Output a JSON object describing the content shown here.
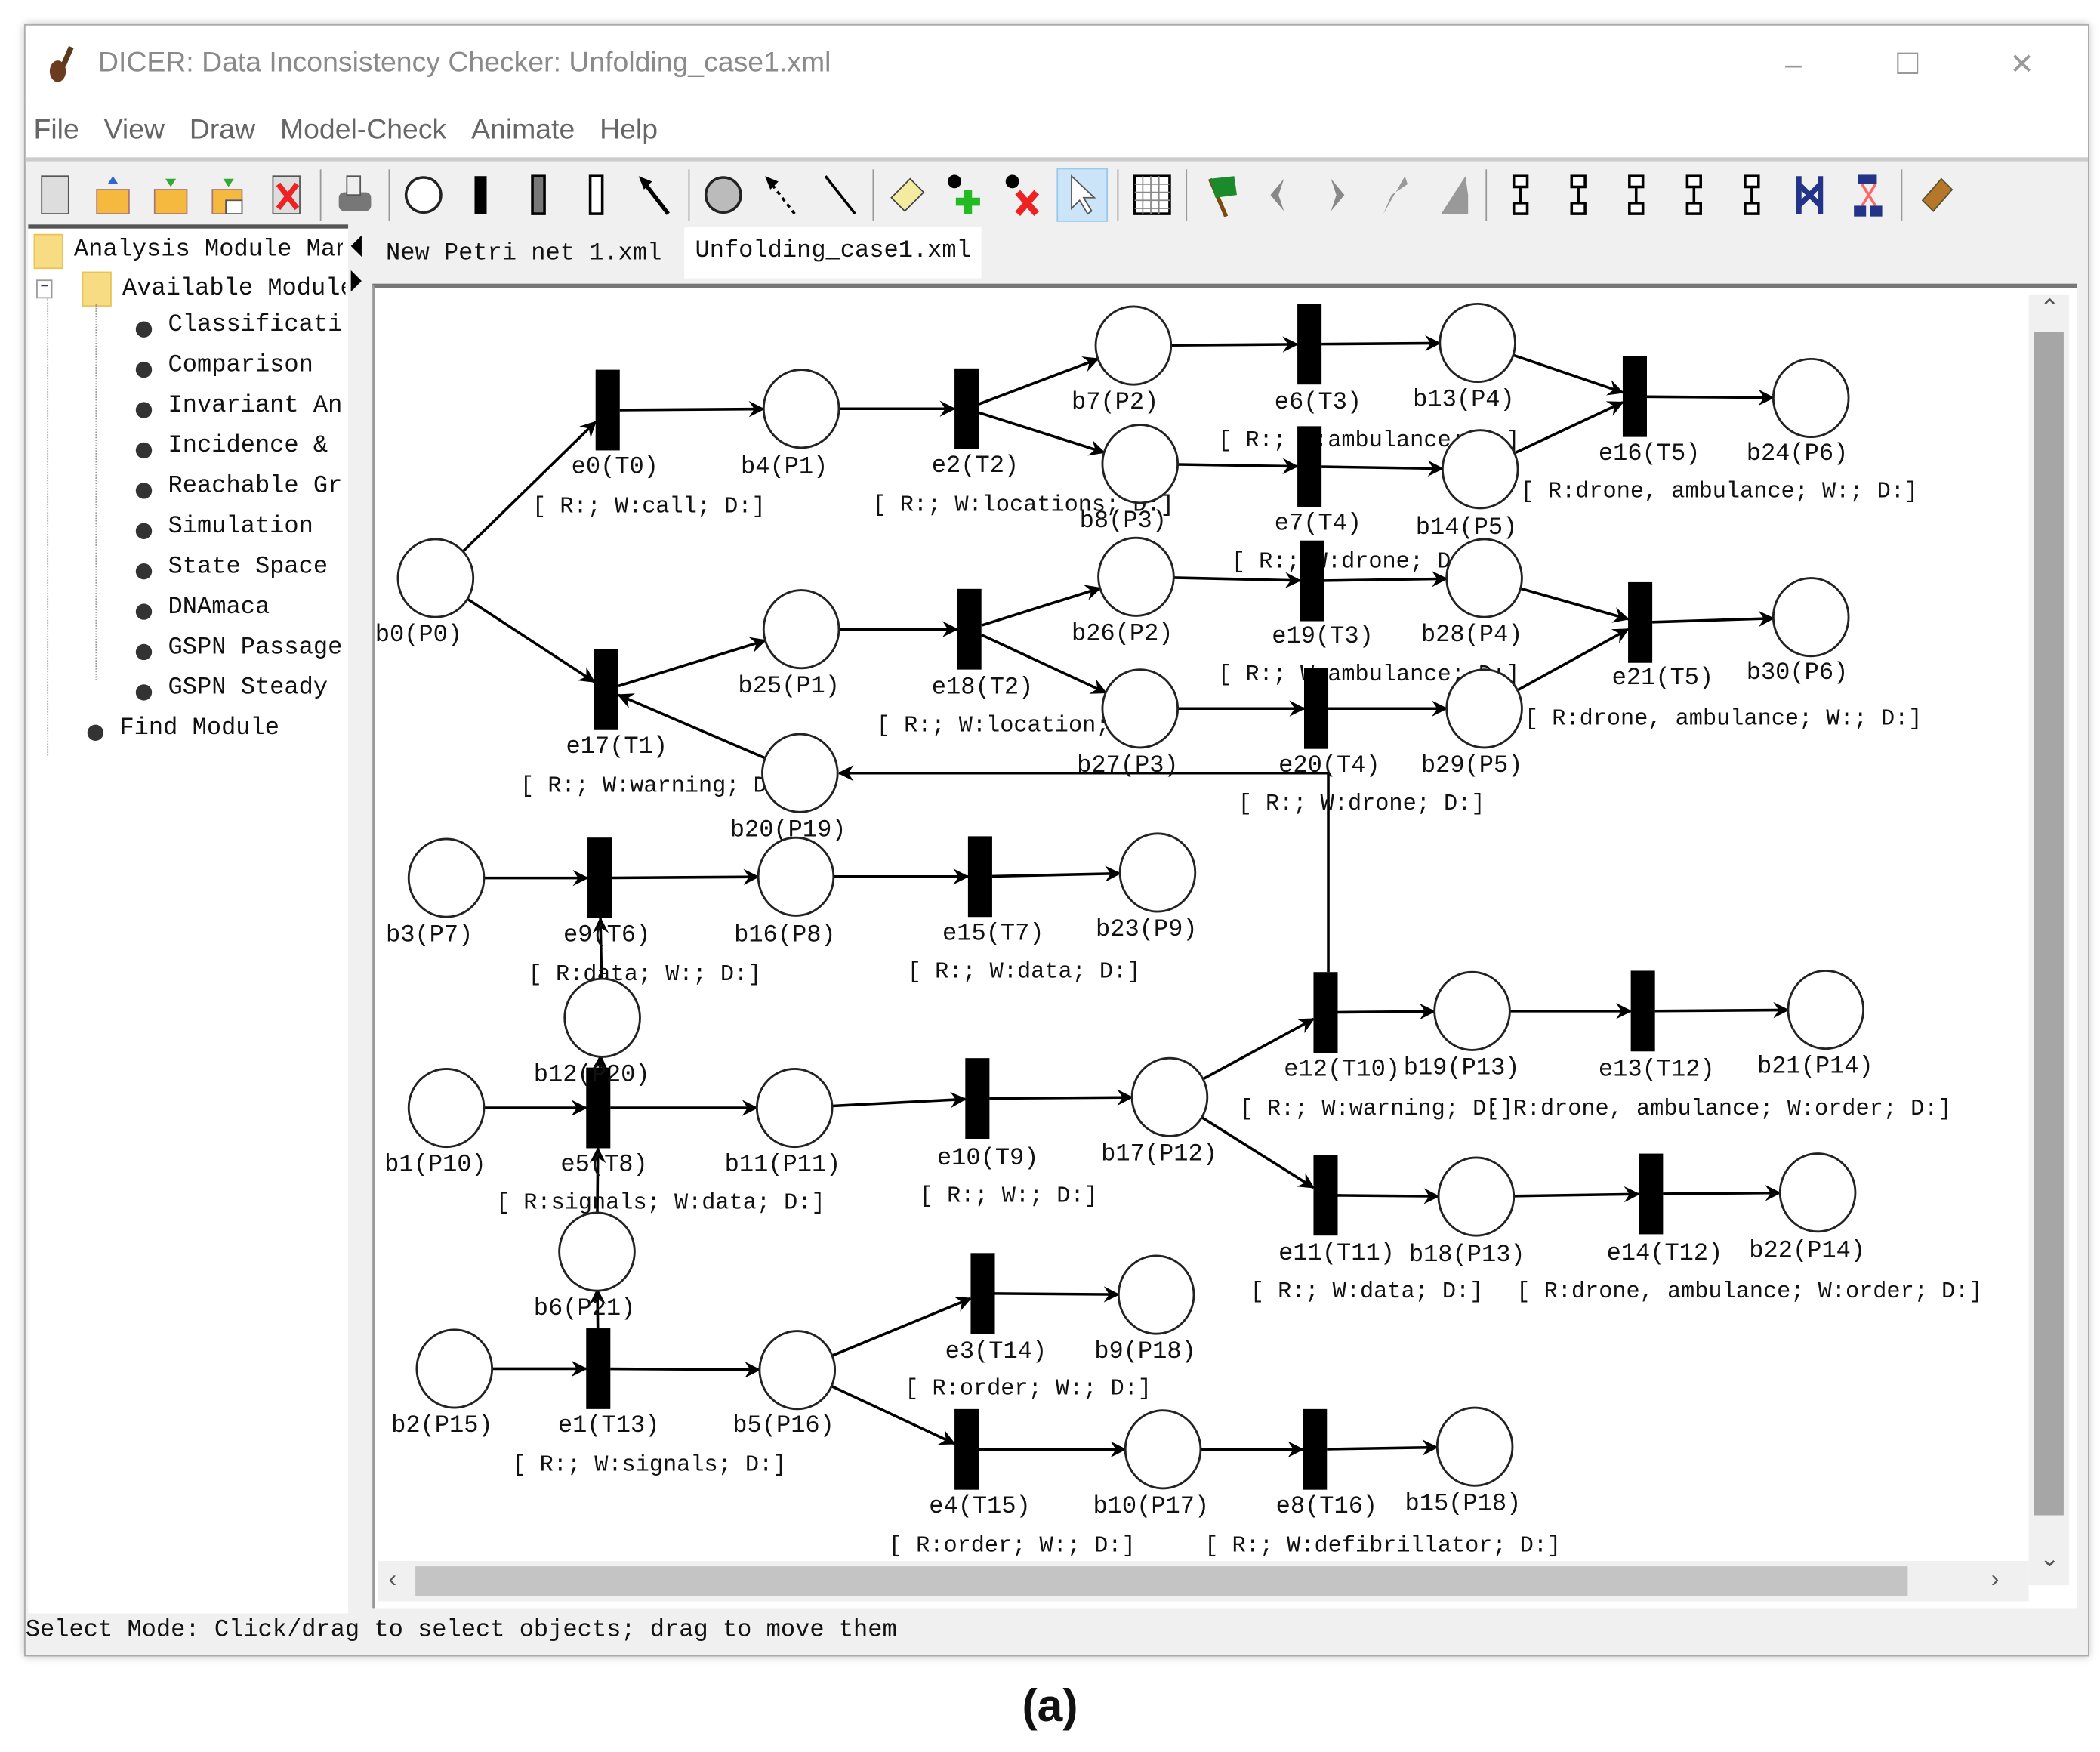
{
  "window": {
    "title": "DICER: Data Inconsistency Checker: Unfolding_case1.xml",
    "controls": {
      "minimize": "–",
      "maximize": "☐",
      "close": "✕"
    }
  },
  "menu": [
    "File",
    "View",
    "Draw",
    "Model-Check",
    "Animate",
    "Help"
  ],
  "toolbar": {
    "groups": [
      [
        "new-file-icon",
        "open-file-icon",
        "save-file-icon",
        "save-as-icon",
        "close-file-icon"
      ],
      [
        "print-icon"
      ],
      [
        "place-icon",
        "immediate-transition-icon",
        "timed-transition-icon",
        "empty-transition-icon",
        "arc-icon"
      ],
      [
        "token-icon",
        "inhibitor-arc-icon",
        "line-icon"
      ],
      [
        "annotation-icon",
        "add-token-icon",
        "delete-token-icon",
        "select-icon"
      ],
      [
        "grid-icon"
      ],
      [
        "animate-flag-icon",
        "step-back-icon",
        "step-forward-icon",
        "random-fire-icon",
        "multi-random-fire-icon"
      ],
      [
        "unfold-icon-1",
        "unfold-icon-2",
        "unfold-icon-3",
        "unfold-icon-4",
        "unfold-icon-5",
        "unfold-icon-6",
        "unfold-icon-7"
      ],
      [
        "help-book-icon"
      ]
    ],
    "selected": "select-icon"
  },
  "tree": {
    "root": "Analysis Module Manager",
    "folder": "Available Modules",
    "modules": [
      "Classification",
      "Comparison",
      "Invariant Analysis",
      "Incidence & Marking",
      "Reachable Graph",
      "Simulation",
      "State Space",
      "DNAmaca",
      "GSPN Passage",
      "GSPN Steady",
      "Find Module"
    ]
  },
  "tabs": [
    {
      "label": "New Petri net 1.xml",
      "active": false
    },
    {
      "label": "Unfolding_case1.xml",
      "active": true
    }
  ],
  "net": {
    "places": [
      {
        "id": "b0",
        "label": "b0(P0)"
      },
      {
        "id": "b4",
        "label": "b4(P1)"
      },
      {
        "id": "b7",
        "label": "b7(P2)"
      },
      {
        "id": "b8",
        "label": "b8(P3)"
      },
      {
        "id": "b13",
        "label": "b13(P4)"
      },
      {
        "id": "b14",
        "label": "b14(P5)"
      },
      {
        "id": "b24",
        "label": "b24(P6)"
      },
      {
        "id": "b25",
        "label": "b25(P1)"
      },
      {
        "id": "b26",
        "label": "b26(P2)"
      },
      {
        "id": "b27",
        "label": "b27(P3)"
      },
      {
        "id": "b28",
        "label": "b28(P4)"
      },
      {
        "id": "b29",
        "label": "b29(P5)"
      },
      {
        "id": "b30",
        "label": "b30(P6)"
      },
      {
        "id": "b20",
        "label": "b20(P19)"
      },
      {
        "id": "b3",
        "label": "b3(P7)"
      },
      {
        "id": "b16",
        "label": "b16(P8)"
      },
      {
        "id": "b23",
        "label": "b23(P9)"
      },
      {
        "id": "b12",
        "label": "b12(P20)"
      },
      {
        "id": "b1",
        "label": "b1(P10)"
      },
      {
        "id": "b11",
        "label": "b11(P11)"
      },
      {
        "id": "b17",
        "label": "b17(P12)"
      },
      {
        "id": "b19",
        "label": "b19(P13)"
      },
      {
        "id": "b21",
        "label": "b21(P14)"
      },
      {
        "id": "b18",
        "label": "b18(P13)"
      },
      {
        "id": "b22",
        "label": "b22(P14)"
      },
      {
        "id": "b6",
        "label": "b6(P21)"
      },
      {
        "id": "b2",
        "label": "b2(P15)"
      },
      {
        "id": "b5",
        "label": "b5(P16)"
      },
      {
        "id": "b9",
        "label": "b9(P18)"
      },
      {
        "id": "b10",
        "label": "b10(P17)"
      },
      {
        "id": "b15",
        "label": "b15(P18)"
      }
    ],
    "transitions": [
      {
        "id": "e0",
        "label": "e0(T0)",
        "annotation": "[ R:; W:call; D:]"
      },
      {
        "id": "e2",
        "label": "e2(T2)",
        "annotation": "[ R:; W:locations; D:]"
      },
      {
        "id": "e6",
        "label": "e6(T3)",
        "annotation": "[ R:; W:ambulance; D:]"
      },
      {
        "id": "e7",
        "label": "e7(T4)",
        "annotation": "[ R:; W:drone; D:]"
      },
      {
        "id": "e16",
        "label": "e16(T5)",
        "annotation": "[ R:drone, ambulance; W:; D:]"
      },
      {
        "id": "e17",
        "label": "e17(T1)",
        "annotation": "[ R:; W:warning; D:]"
      },
      {
        "id": "e18",
        "label": "e18(T2)",
        "annotation": "[ R:; W:location; D:]"
      },
      {
        "id": "e19",
        "label": "e19(T3)",
        "annotation": "[ R:; W:ambulance; D:]"
      },
      {
        "id": "e20",
        "label": "e20(T4)",
        "annotation": "[ R:; W:drone; D:]"
      },
      {
        "id": "e21",
        "label": "e21(T5)",
        "annotation": "[ R:drone, ambulance; W:; D:]"
      },
      {
        "id": "e9",
        "label": "e9(T6)",
        "annotation": "[ R:data; W:; D:]"
      },
      {
        "id": "e15",
        "label": "e15(T7)",
        "annotation": "[ R:; W:data; D:]"
      },
      {
        "id": "e12",
        "label": "e12(T10)",
        "annotation": "[ R:; W:warning; D:]"
      },
      {
        "id": "e13",
        "label": "e13(T12)",
        "annotation": "[ R:drone, ambulance; W:order; D:]"
      },
      {
        "id": "e5",
        "label": "e5(T8)",
        "annotation": "[ R:signals; W:data; D:]"
      },
      {
        "id": "e10",
        "label": "e10(T9)",
        "annotation": "[ R:; W:; D:]"
      },
      {
        "id": "e11",
        "label": "e11(T11)",
        "annotation": "[ R:; W:data; D:]"
      },
      {
        "id": "e14",
        "label": "e14(T12)",
        "annotation": "[ R:drone, ambulance; W:order; D:]"
      },
      {
        "id": "e1",
        "label": "e1(T13)",
        "annotation": "[ R:; W:signals; D:]"
      },
      {
        "id": "e3",
        "label": "e3(T14)",
        "annotation": "[ R:order; W:; D:]"
      },
      {
        "id": "e4",
        "label": "e4(T15)",
        "annotation": "[ R:order; W:; D:]"
      },
      {
        "id": "e8",
        "label": "e8(T16)",
        "annotation": "[ R:; W:defibrillator; D:]"
      }
    ],
    "arcs": [
      [
        "b0",
        "e0"
      ],
      [
        "b0",
        "e17"
      ],
      [
        "e0",
        "b4"
      ],
      [
        "b4",
        "e2"
      ],
      [
        "e2",
        "b7"
      ],
      [
        "e2",
        "b8"
      ],
      [
        "b7",
        "e6"
      ],
      [
        "e6",
        "b13"
      ],
      [
        "b8",
        "e7"
      ],
      [
        "e7",
        "b14"
      ],
      [
        "b13",
        "e16"
      ],
      [
        "b14",
        "e16"
      ],
      [
        "e16",
        "b24"
      ],
      [
        "e17",
        "b25"
      ],
      [
        "b25",
        "e18"
      ],
      [
        "e18",
        "b26"
      ],
      [
        "e18",
        "b27"
      ],
      [
        "b26",
        "e19"
      ],
      [
        "e19",
        "b28"
      ],
      [
        "b27",
        "e20"
      ],
      [
        "e20",
        "b29"
      ],
      [
        "b28",
        "e21"
      ],
      [
        "b29",
        "e21"
      ],
      [
        "e21",
        "b30"
      ],
      [
        "b20",
        "e17"
      ],
      [
        "e12",
        "b20"
      ],
      [
        "b3",
        "e9"
      ],
      [
        "e9",
        "b16"
      ],
      [
        "b16",
        "e15"
      ],
      [
        "e15",
        "b23"
      ],
      [
        "b12",
        "e9"
      ],
      [
        "e5",
        "b12"
      ],
      [
        "b1",
        "e5"
      ],
      [
        "e5",
        "b11"
      ],
      [
        "b11",
        "e10"
      ],
      [
        "e10",
        "b17"
      ],
      [
        "b17",
        "e12"
      ],
      [
        "b17",
        "e11"
      ],
      [
        "e12",
        "b19"
      ],
      [
        "b19",
        "e13"
      ],
      [
        "e13",
        "b21"
      ],
      [
        "e11",
        "b18"
      ],
      [
        "b18",
        "e14"
      ],
      [
        "e14",
        "b22"
      ],
      [
        "b6",
        "e5"
      ],
      [
        "e1",
        "b6"
      ],
      [
        "b2",
        "e1"
      ],
      [
        "e1",
        "b5"
      ],
      [
        "b5",
        "e3"
      ],
      [
        "b5",
        "e4"
      ],
      [
        "e3",
        "b9"
      ],
      [
        "e4",
        "b10"
      ],
      [
        "b10",
        "e8"
      ],
      [
        "e8",
        "b15"
      ]
    ]
  },
  "status": "Select Mode: Click/drag to select objects; drag to move them",
  "caption": "(a)"
}
